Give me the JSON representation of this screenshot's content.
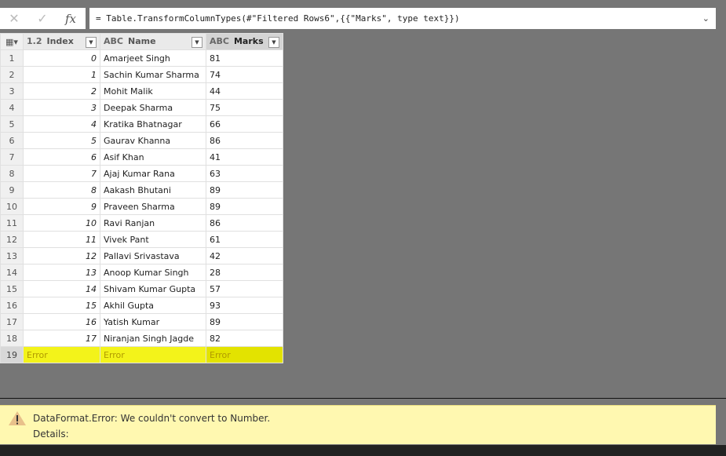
{
  "formula_bar": {
    "cancel_icon": "close-icon",
    "confirm_icon": "check-icon",
    "fx_label": "fx",
    "formula": "= Table.TransformColumnTypes(#\"Filtered Rows6\",{{\"Marks\", type text}})"
  },
  "columns": [
    {
      "type": "1.2",
      "name": "Index"
    },
    {
      "type": "ABC",
      "name": "Name"
    },
    {
      "type": "ABC",
      "name": "Marks"
    }
  ],
  "rows": [
    [
      "1",
      "0",
      "Amarjeet Singh",
      "81"
    ],
    [
      "2",
      "1",
      "Sachin Kumar Sharma",
      "74"
    ],
    [
      "3",
      "2",
      "Mohit Malik",
      "44"
    ],
    [
      "4",
      "3",
      "Deepak Sharma",
      "75"
    ],
    [
      "5",
      "4",
      "Kratika Bhatnagar",
      "66"
    ],
    [
      "6",
      "5",
      "Gaurav Khanna",
      "86"
    ],
    [
      "7",
      "6",
      "Asif Khan",
      "41"
    ],
    [
      "8",
      "7",
      "Ajaj Kumar Rana",
      "63"
    ],
    [
      "9",
      "8",
      "Aakash Bhutani",
      "89"
    ],
    [
      "10",
      "9",
      "Praveen Sharma",
      "89"
    ],
    [
      "11",
      "10",
      "Ravi Ranjan",
      "86"
    ],
    [
      "12",
      "11",
      "Vivek Pant",
      "61"
    ],
    [
      "13",
      "12",
      "Pallavi Srivastava",
      "42"
    ],
    [
      "14",
      "13",
      "Anoop Kumar Singh",
      "28"
    ],
    [
      "15",
      "14",
      "Shivam Kumar Gupta",
      "57"
    ],
    [
      "16",
      "15",
      "Akhil Gupta",
      "93"
    ],
    [
      "17",
      "16",
      "Yatish Kumar",
      "89"
    ],
    [
      "18",
      "17",
      "Niranjan Singh Jagde",
      "82"
    ]
  ],
  "error_row": [
    "19",
    "Error",
    "Error",
    "Error"
  ],
  "error_panel": {
    "message": "DataFormat.Error: We couldn't convert to Number.",
    "details": "Details:",
    "icon": "warning-icon"
  },
  "colors": {
    "highlight": "#f3f31a",
    "error_panel": "#fff8b0"
  }
}
